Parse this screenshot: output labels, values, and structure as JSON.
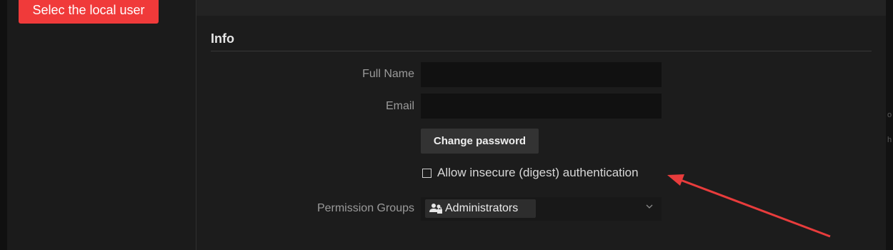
{
  "annotation": {
    "callout_text": "Selec the local user"
  },
  "info": {
    "title": "Info",
    "full_name": {
      "label": "Full Name",
      "value": ""
    },
    "email": {
      "label": "Email",
      "value": ""
    },
    "change_password_label": "Change password",
    "insecure_auth": {
      "label": "Allow insecure (digest) authentication",
      "checked": false
    },
    "permission_groups": {
      "label": "Permission Groups",
      "selected": "Administrators"
    }
  },
  "icons": {
    "chip_icon": "user-group-icon",
    "select_chevron": "chevron-down-icon",
    "annotation_arrow": "red-arrow"
  },
  "colors": {
    "callout": "#f03a3a",
    "background": "#1c1c1c",
    "input": "#111111",
    "button": "#333333",
    "arrow": "#e83c3c"
  }
}
